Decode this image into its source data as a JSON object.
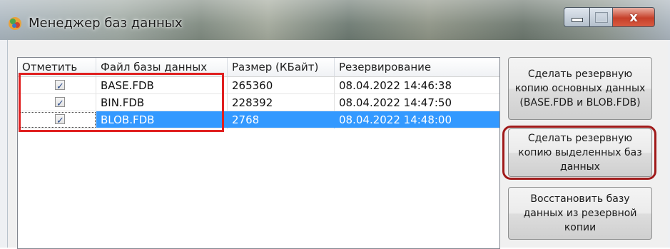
{
  "window": {
    "title": "Менеджер баз данных",
    "icon": "app-database-icon",
    "controls": [
      "minimize",
      "maximize",
      "close"
    ]
  },
  "table": {
    "columns": [
      "Отметить",
      "Файл базы данных",
      "Размер (КБайт)",
      "Резервирование"
    ],
    "rows": [
      {
        "checked": true,
        "file": "BASE.FDB",
        "size": "265360",
        "backup": "08.04.2022 14:46:38",
        "selected": false
      },
      {
        "checked": true,
        "file": "BIN.FDB",
        "size": "228392",
        "backup": "08.04.2022 14:47:50",
        "selected": false
      },
      {
        "checked": true,
        "file": "BLOB.FDB",
        "size": "2768",
        "backup": "08.04.2022 14:48:00",
        "selected": true
      }
    ]
  },
  "buttons": {
    "backup_main": "Сделать резервную копию основных данных (BASE.FDB и BLOB.FDB)",
    "backup_selected": "Сделать резервную копию выделенных баз данных",
    "restore": "Восстановить базу данных из резервной копии"
  },
  "colors": {
    "selection": "#3399ff",
    "highlight_red": "#e02020",
    "highlight_dark_red": "#a01a1a",
    "close_button": "#c6402a"
  }
}
